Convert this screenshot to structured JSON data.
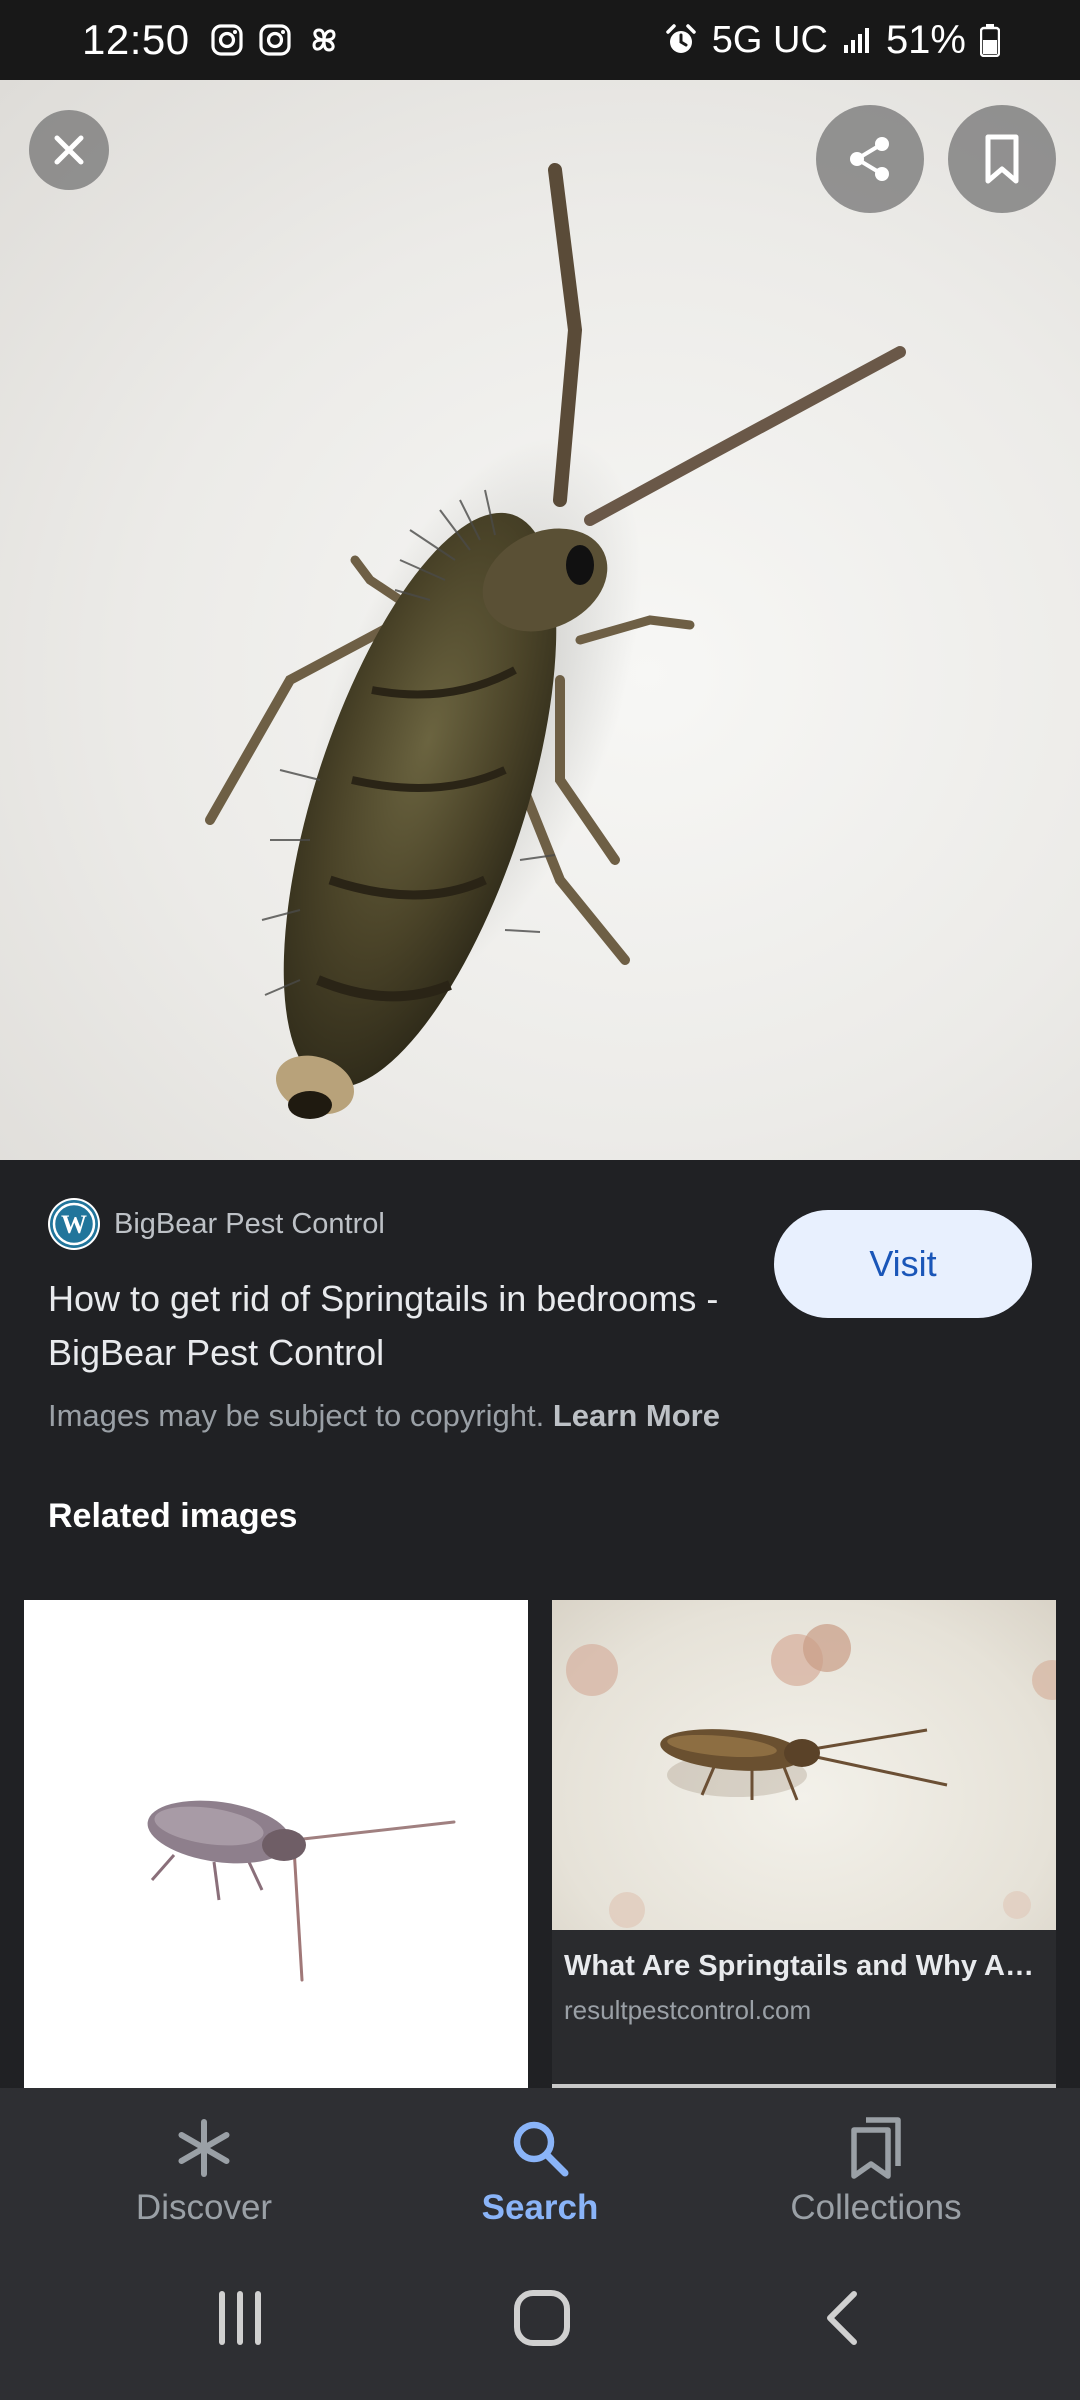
{
  "status_bar": {
    "time": "12:50",
    "network": "5G UC",
    "battery": "51%",
    "notification_icons": [
      "instagram-icon",
      "instagram-icon",
      "pinwheel-icon"
    ]
  },
  "hero": {
    "close_icon": "close-icon",
    "share_icon": "share-icon",
    "bookmark_icon": "bookmark-icon"
  },
  "result": {
    "source_name": "BigBear Pest Control",
    "title": "How to get rid of Springtails in bedrooms - BigBear Pest Control",
    "visit_label": "Visit",
    "copyright_text": "Images may be subject to copyright.",
    "learn_more_label": "Learn More"
  },
  "related": {
    "heading": "Related images",
    "cards": [
      {
        "caption": "",
        "domain": ""
      },
      {
        "caption": "What Are Springtails and Why Ar…",
        "domain": "resultpestcontrol.com"
      }
    ]
  },
  "bottom_nav": {
    "items": [
      {
        "label": "Discover",
        "icon": "asterisk-icon",
        "active": false
      },
      {
        "label": "Search",
        "icon": "search-icon",
        "active": true
      },
      {
        "label": "Collections",
        "icon": "collections-icon",
        "active": false
      }
    ]
  },
  "colors": {
    "background": "#202124",
    "accent": "#8ab4f8",
    "visit_button_bg": "#e8f0fe",
    "visit_button_text": "#1a56b8"
  }
}
